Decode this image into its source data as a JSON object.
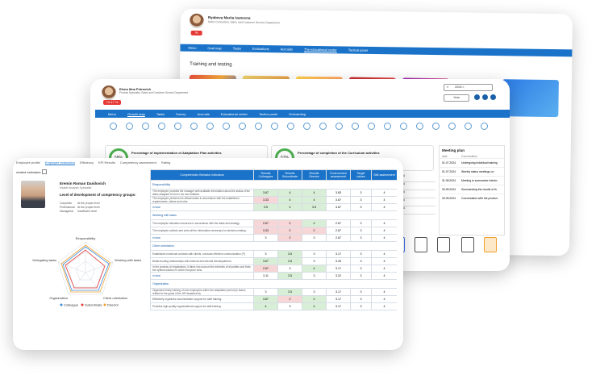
{
  "back": {
    "user_name": "Ryabova Mariia Ivanovna",
    "user_role": "Sales Consultant, Sales and Customer Service Department",
    "nav": [
      "Menu",
      "Goal map",
      "Tasks",
      "Evaluations",
      "Accruals",
      "The educational center",
      "Tactical panel"
    ],
    "section_title": "Training and testing"
  },
  "middle": {
    "user_name": "Elena Ilina Petrovich",
    "user_role": "Product Specialist, Sales and Customer Service Department",
    "badge": "+0.47 %",
    "nav": [
      "Menu",
      "Growth map",
      "Tasks",
      "Survey",
      "Accruals",
      "Educational center",
      "Tactics panel",
      "Onboarding"
    ],
    "search_value": "2024 г.",
    "year_button": "Year",
    "card1_title": "Percentage of implementation of Adaptation Plan activities",
    "card1_value": "58%",
    "card2_title": "Percentage of completion of the Curriculum activities",
    "card2_value": "57%",
    "meeting_title": "Meeting plan",
    "meeting_headers": [
      "date",
      "Conversation"
    ],
    "meetings": [
      {
        "date": "01.07.2024",
        "text": "Undergoing individual training"
      },
      {
        "date": "01.07.2024",
        "text": "Weekly status meetings on"
      },
      {
        "date": "31.08.2024",
        "text": "Meeting to summarize interim"
      },
      {
        "date": "30.06.2024",
        "text": "Summarizing the results of th"
      },
      {
        "date": "30.06.2024",
        "text": "Conversation with the product"
      }
    ],
    "dates": [
      "01.07.2024",
      "01.07.2024",
      "01.07.2024",
      "01.07.2024",
      "01.07.2024"
    ]
  },
  "front": {
    "tabs": [
      "Employee profile",
      "Employee evaluation",
      "Efficiency",
      "KPI Results",
      "Competency assessment",
      "Rating"
    ],
    "related_label": "related estimates",
    "employee_name": "Eremin Roman Danilovich",
    "employee_role": "Market Analysis Specialist",
    "competency_title": "Level of development of competency groups:",
    "levels": [
      {
        "group": "Corporate",
        "level": "At the proper level"
      },
      {
        "group": "Professional",
        "level": "At the proper level"
      },
      {
        "group": "Managerial",
        "level": "Insufficient level"
      }
    ],
    "radar_axes": [
      "Responsibility",
      "Working with tasks",
      "Client orientation",
      "Organization",
      "Delegating tasks"
    ],
    "legend": [
      "Colleague",
      "Subordinate",
      "Director"
    ],
    "table_headers": [
      "Competencies Behavior indicators",
      "Results Colleagues",
      "Results Subordinate",
      "Results Director",
      "Environment assessment",
      "Target values",
      "Self-assessment"
    ],
    "sections": [
      {
        "title": "Responsibility",
        "rows": [
          {
            "text": "The employee provides the manager with available information about the status of the tasks assigned to him in his own initiative.",
            "v": [
              "3.67",
              "4",
              "4",
              "3.83",
              "3",
              "4"
            ]
          },
          {
            "text": "The employee performs his official duties in accordance with the established requirements, claims and rules.",
            "v": [
              "3.33",
              "4",
              "4",
              "3.67",
              "3",
              "4"
            ]
          },
          {
            "text": "In total",
            "v": [
              "3.5",
              "4",
              "3.5",
              "3.67",
              "3",
              "4"
            ]
          }
        ]
      },
      {
        "title": "Working with tasks",
        "rows": [
          {
            "text": "The employee allocates resources in accordance with the tasks and strategy.",
            "v": [
              "2.67",
              "2",
              "4",
              "2.67",
              "3",
              "4"
            ]
          },
          {
            "text": "The employee collects and sorts all the information necessary for decision-making.",
            "v": [
              "3.33",
              "2",
              "2",
              "2.67",
              "3",
              "4"
            ]
          },
          {
            "text": "In total",
            "v": [
              "3",
              "2",
              "3",
              "2.67",
              "3",
              "4"
            ]
          }
        ]
      },
      {
        "title": "Client orientation",
        "rows": [
          {
            "text": "Establishes emotional contacts with clients, conducts effective communication (P).",
            "v": [
              "3",
              "3.5",
              "3",
              "3.17",
              "3",
              "4"
            ]
          },
          {
            "text": "Builds trusting relationships with external and internal clients/partners.",
            "v": [
              "3.67",
              "3.5",
              "3",
              "3.33",
              "3",
              "4"
            ]
          },
          {
            "text": "In the process of negotiations, it takes into account the interests of all parties and finds the optimal solution in which everyone wins.",
            "v": [
              "2.67",
              "3",
              "4",
              "3.17",
              "3",
              "4"
            ]
          },
          {
            "text": "In total",
            "v": [
              "3.11",
              "3.5",
              "3",
              "3.22",
              "3",
              "4"
            ]
          }
        ]
      },
      {
        "title": "Organization",
        "rows": [
          {
            "text": "Organizes timely training of new employees within the adaptation period (in teams related to the goals of the HR department).",
            "v": [
              "3",
              "3.5",
              "3",
              "3.17",
              "3",
              "4"
            ]
          },
          {
            "text": "Effectively organizes documentation support for staff training.",
            "v": [
              "3.67",
              "2",
              "4",
              "3.17",
              "3",
              "4"
            ]
          },
          {
            "text": "Provides high-quality organizational support for staff training.",
            "v": [
              "4",
              "3",
              "4",
              "3.17",
              "3",
              "4"
            ]
          }
        ]
      }
    ]
  },
  "colors": {
    "accent": "#1a73c9",
    "red_cell": "#f6d6d6",
    "green_cell": "#d8eed6",
    "badge": "#e53935"
  }
}
